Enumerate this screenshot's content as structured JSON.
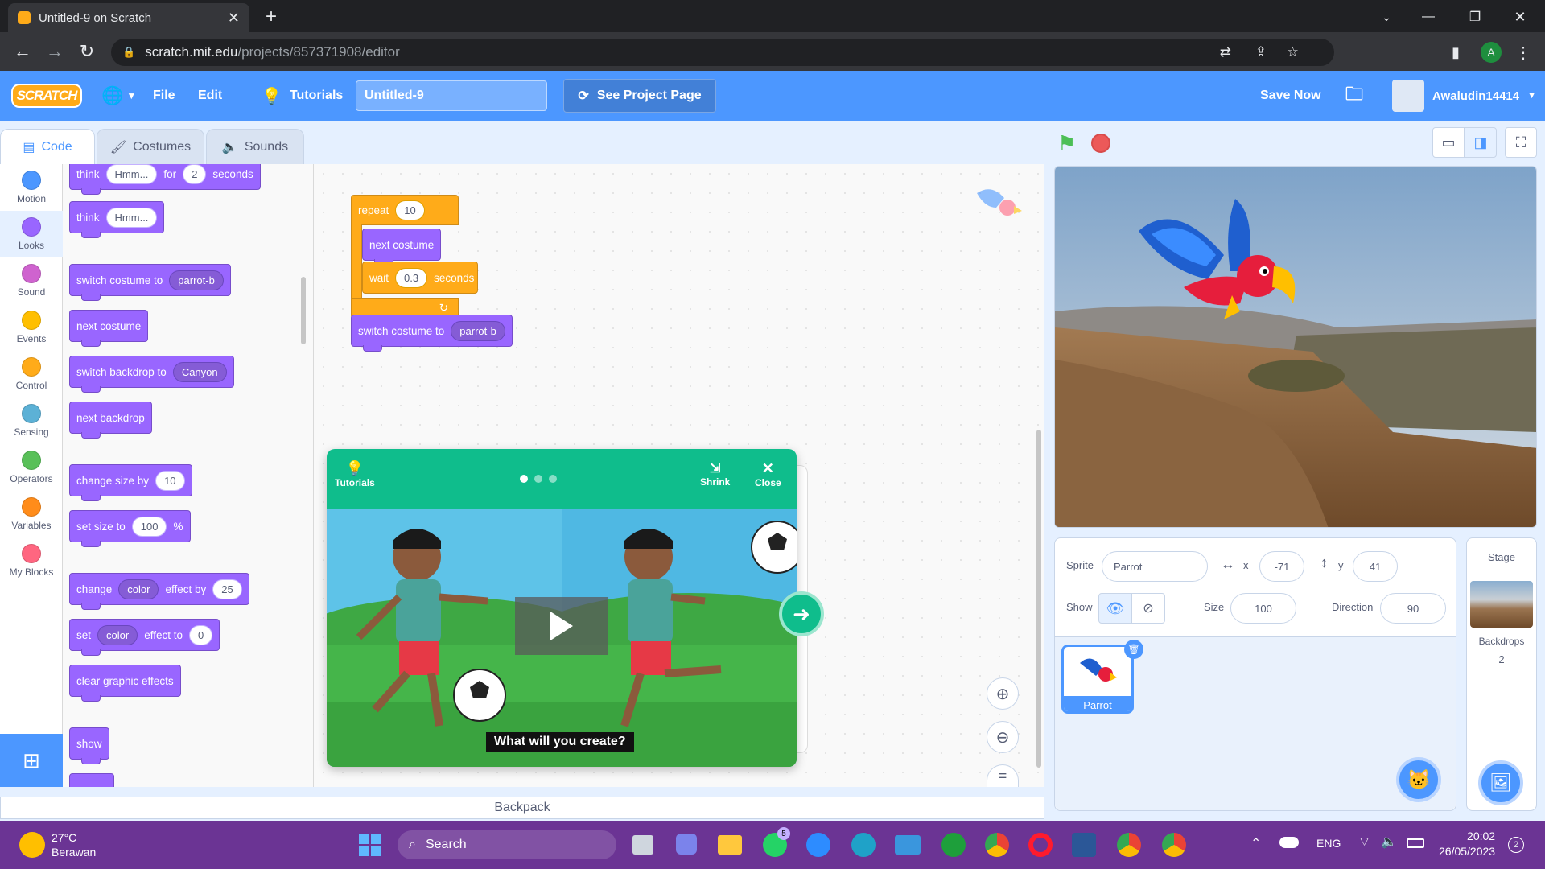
{
  "browser": {
    "tab_title": "Untitled-9 on Scratch",
    "url_domain": "scratch.mit.edu",
    "url_path": "/projects/857371908/editor",
    "profile_initial": "A"
  },
  "menu": {
    "logo": "SCRATCH",
    "file": "File",
    "edit": "Edit",
    "tutorials": "Tutorials",
    "project_title": "Untitled-9",
    "see_project": "See Project Page",
    "save_now": "Save Now",
    "username": "Awaludin14414"
  },
  "tabs": {
    "code": "Code",
    "costumes": "Costumes",
    "sounds": "Sounds"
  },
  "categories": [
    {
      "label": "Motion",
      "color": "#4c97ff"
    },
    {
      "label": "Looks",
      "color": "#9966ff"
    },
    {
      "label": "Sound",
      "color": "#cf63cf"
    },
    {
      "label": "Events",
      "color": "#ffbf00"
    },
    {
      "label": "Control",
      "color": "#ffab19"
    },
    {
      "label": "Sensing",
      "color": "#5cb1d6"
    },
    {
      "label": "Operators",
      "color": "#59c059"
    },
    {
      "label": "Variables",
      "color": "#ff8c1a"
    },
    {
      "label": "My Blocks",
      "color": "#ff6680"
    }
  ],
  "palette": {
    "think_for": {
      "word": "think",
      "msg": "Hmm...",
      "for": "for",
      "secs": "2",
      "unit": "seconds"
    },
    "think": {
      "word": "think",
      "msg": "Hmm..."
    },
    "switch_costume": {
      "label": "switch costume to",
      "value": "parrot-b"
    },
    "next_costume": "next costume",
    "switch_backdrop": {
      "label": "switch backdrop to",
      "value": "Canyon"
    },
    "next_backdrop": "next backdrop",
    "change_size": {
      "label": "change size by",
      "value": "10"
    },
    "set_size": {
      "label": "set size to",
      "value": "100",
      "unit": "%"
    },
    "change_effect": {
      "label": "change",
      "effect": "color",
      "mid": "effect by",
      "value": "25"
    },
    "set_effect": {
      "label": "set",
      "effect": "color",
      "mid": "effect to",
      "value": "0"
    },
    "clear_effects": "clear graphic effects",
    "show": "show"
  },
  "script": {
    "repeat": "repeat",
    "repeat_n": "10",
    "next_costume": "next costume",
    "wait": "wait",
    "wait_n": "0.3",
    "seconds": "seconds",
    "switch_costume": "switch costume to",
    "costume": "parrot-b"
  },
  "tutorial": {
    "title": "Tutorials",
    "shrink": "Shrink",
    "close": "Close",
    "caption": "What will you create?"
  },
  "sprite": {
    "sprite_label": "Sprite",
    "name": "Parrot",
    "x_label": "x",
    "x": "-71",
    "y_label": "y",
    "y": "41",
    "show_label": "Show",
    "size_label": "Size",
    "size": "100",
    "direction_label": "Direction",
    "direction": "90",
    "thumb_name": "Parrot"
  },
  "stage_panel": {
    "title": "Stage",
    "backdrops_label": "Backdrops",
    "backdrops_count": "2"
  },
  "backpack": "Backpack",
  "taskbar": {
    "temp": "27°C",
    "weather": "Berawan",
    "search": "Search",
    "badge": "5",
    "lang": "ENG",
    "time": "20:02",
    "date": "26/05/2023",
    "notif": "2"
  }
}
